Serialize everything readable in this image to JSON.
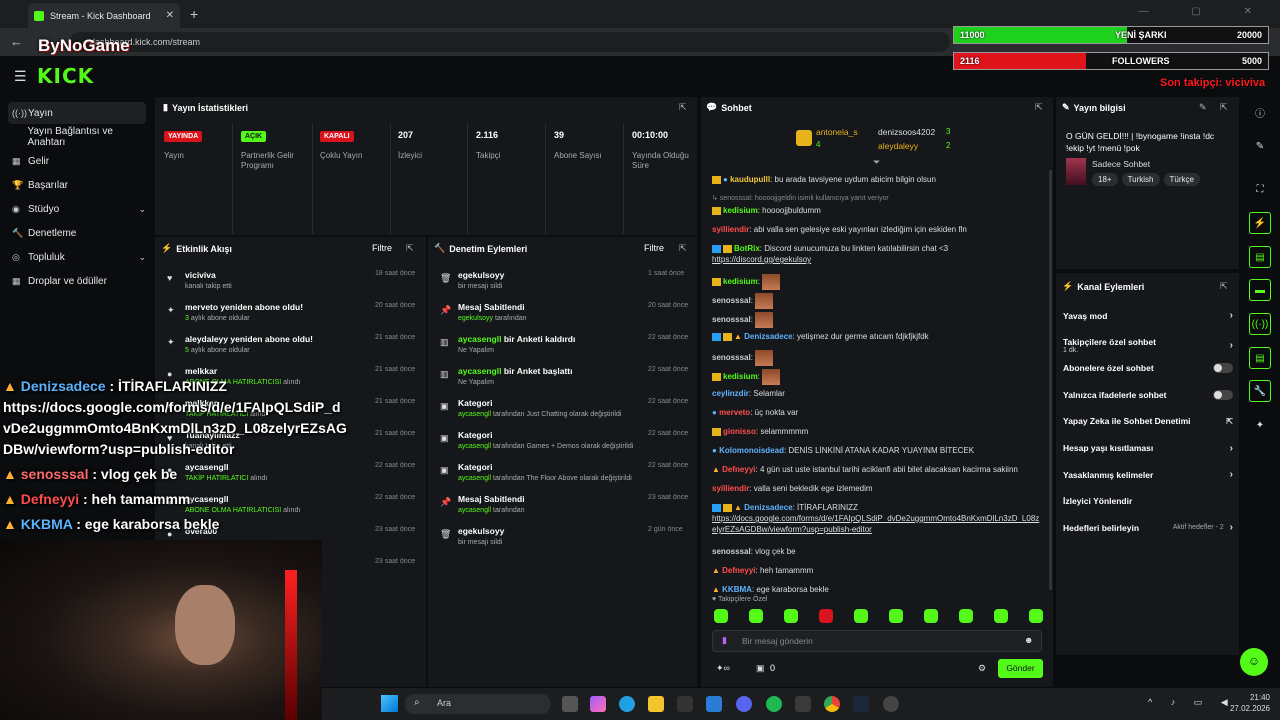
{
  "browser": {
    "tab_title": "Stream - Kick Dashboard",
    "url": "dashboard.kick.com/stream",
    "new_tab": "+",
    "close": "✕",
    "winctl": "— ▢ ✕"
  },
  "overlay_logo": "ByNoGame",
  "logo": "KICK",
  "goals": [
    {
      "left": "11000",
      "label": "YENİ ŞARKI",
      "right": "20000",
      "fill_fraction": 0.55,
      "color": "#1fd11f"
    },
    {
      "left": "2116",
      "label": "FOLLOWERS",
      "right": "5000",
      "fill_fraction": 0.42,
      "color": "#e0151c"
    }
  ],
  "last_follower": "Son takipçi: viciviva",
  "sidebar": [
    {
      "label": "Yayın",
      "icon": "((·))",
      "active": true
    },
    {
      "label": "Yayın Bağlantısı ve Anahtarı",
      "icon": ""
    },
    {
      "label": "Gelir",
      "icon": "▦"
    },
    {
      "label": "Başarılar",
      "icon": "🏆"
    },
    {
      "label": "Stüdyo",
      "icon": "◉",
      "chevron": "⌄"
    },
    {
      "label": "Denetleme",
      "icon": "🔨"
    },
    {
      "label": "Topluluk",
      "icon": "◎",
      "chevron": "⌄"
    },
    {
      "label": "Droplar ve ödüller",
      "icon": "▦"
    }
  ],
  "stats": {
    "title": "Yayın İstatistikleri",
    "items": [
      {
        "value": "YAYINDA",
        "label": "Yayın",
        "badge": "#d9131b"
      },
      {
        "value": "AÇIK",
        "label": "Partnerlik Gelir Programı",
        "badge": "#53fc18"
      },
      {
        "value": "KAPALI",
        "label": "Çoklu Yayın",
        "badge": "#d9131b"
      },
      {
        "value": "207",
        "label": "İzleyici"
      },
      {
        "value": "2.116",
        "label": "Takipçi"
      },
      {
        "value": "39",
        "label": "Abone Sayısı"
      },
      {
        "value": "00:10:00",
        "label": "Yayında Olduğu Süre"
      }
    ]
  },
  "activity": {
    "title": "Etkinlik Akışı",
    "filter": "Filtre",
    "rows": [
      {
        "title": "viciviva",
        "sub": "kanalı takip etti",
        "time": "18 saat önce",
        "icon": "♥"
      },
      {
        "title": "merveto yeniden abone oldu!",
        "sub_green": "3",
        "sub": " aylık abone oldular",
        "time": "20 saat önce",
        "icon": "✦"
      },
      {
        "title": "aleydaleyy yeniden abone oldu!",
        "sub_green": "5",
        "sub": " aylık abone oldular",
        "time": "21 saat önce",
        "icon": "✦"
      },
      {
        "title": "melkkar",
        "sub_green": "ABONE OLMA HATIRLATICISI",
        "sub": " alındı",
        "time": "21 saat önce",
        "icon": "●"
      },
      {
        "title": "melkkar",
        "sub_green": "TAKİP HATIRLATICI",
        "sub": " alındı",
        "time": "21 saat önce",
        "icon": "●"
      },
      {
        "title": "Tuanaylimazz",
        "sub": "kanalı takip etti",
        "time": "21 saat önce",
        "icon": "♥"
      },
      {
        "title": "aycasengll",
        "sub_green": "TAKİP HATIRLATICI",
        "sub": " alındı",
        "time": "22 saat önce",
        "icon": "●"
      },
      {
        "title": "aycasengll",
        "sub_green": "ABONE OLMA HATIRLATICISI",
        "sub": " alındı",
        "time": "22 saat önce",
        "icon": "●"
      },
      {
        "title": "overa00",
        "sub": "",
        "time": "23 saat önce",
        "icon": "●"
      },
      {
        "title": "",
        "sub": "",
        "time": "23 saat önce",
        "icon": ""
      }
    ]
  },
  "moderation": {
    "title": "Denetim Eylemleri",
    "filter": "Filtre",
    "rows": [
      {
        "title": "egekulsoyy",
        "sub": "bir mesajı sildi",
        "time": "1 saat önce",
        "icon": "🗑"
      },
      {
        "title": "Mesaj Sabitlendi",
        "sub_green": "egekulsoyy",
        "sub": " tarafından",
        "time": "20 saat önce",
        "icon": "📌"
      },
      {
        "title_green": "aycasengll",
        "title": " bir Anketi kaldırdı",
        "sub": "Ne Yapalım",
        "time": "22 saat önce",
        "icon": "▥"
      },
      {
        "title_green": "aycasengll",
        "title": " bir Anket başlattı",
        "sub": "Ne Yapalım",
        "time": "22 saat önce",
        "icon": "▥"
      },
      {
        "title": "Kategori",
        "sub_green": "aycasengll",
        "sub": " tarafından Just Chatting olarak değiştirildi",
        "time": "22 saat önce",
        "icon": "▣"
      },
      {
        "title": "Kategori",
        "sub_green": "aycasengll",
        "sub": " tarafından Games + Demos olarak değiştirildi",
        "time": "22 saat önce",
        "icon": "▣"
      },
      {
        "title": "Kategori",
        "sub_green": "aycasengll",
        "sub": " tarafından The Floor Above olarak değiştirildi",
        "time": "22 saat önce",
        "icon": "▣"
      },
      {
        "title": "Mesaj Sabitlendi",
        "sub_green": "aycasengll",
        "sub": " tarafından",
        "time": "23 saat önce",
        "icon": "📌"
      },
      {
        "title": "egekulsoyy",
        "sub": "bir mesajı sildi",
        "time": "2 gün önce",
        "icon": "🗑"
      }
    ]
  },
  "chat": {
    "title": "Sohbet",
    "top_users": [
      {
        "name": "antonela_s",
        "count": "4"
      },
      {
        "name": "denizsoos4202",
        "count": "3"
      },
      {
        "name": "aleydaleyy",
        "count": "2"
      }
    ],
    "messages": [
      {
        "user": "kaudupulll",
        "color": "#f0c93a",
        "text": ": bu arada tavsiyene uydum abicim bilgin olsun",
        "badges": "crown drop"
      },
      {
        "reply": "↳ senosssal: hoooojjgeldin isimli kullanıcıya yanıt veriyor"
      },
      {
        "user": "kedisium",
        "color": "#53fc18",
        "text": ": hoooojjbuldumm",
        "badges": "crown"
      },
      {
        "user": "syilliendir",
        "color": "#ff4d4d",
        "text": ": abi valla sen gelesiye eski yayınları izlediğim için eskiden fln",
        "badges": ""
      },
      {
        "user": "BotRix",
        "color": "#53fc18",
        "text": ": Discord sunucumuza bu linkten katılabilirsin chat <3",
        "link": "https://discord.gg/egekulsoy",
        "badges": "blue crown"
      },
      {
        "user": "kedisium",
        "color": "#53fc18",
        "text": ":",
        "emote": true,
        "badges": "crown"
      },
      {
        "user": "senosssal",
        "color": "#cccccc",
        "text": ":",
        "emote": true,
        "badges": ""
      },
      {
        "user": "senosssal",
        "color": "#cccccc",
        "text": ":",
        "emote": true,
        "badges": ""
      },
      {
        "user": "Denizsadece",
        "color": "#5cb3ff",
        "text": ": yetişmez dur germe atıcam fdjkfjkjfdk",
        "badges": "blue crown fire"
      },
      {
        "user": "senosssal",
        "color": "#cccccc",
        "text": ":",
        "emote": true,
        "badges": ""
      },
      {
        "user": "kedisium",
        "color": "#53fc18",
        "text": ":",
        "emote": true,
        "badges": "crown"
      },
      {
        "user": "ceylinzdir",
        "color": "#5cb3ff",
        "text": ": Selamlar",
        "badges": ""
      },
      {
        "user": "merveto",
        "color": "#ff4d4d",
        "text": ": üç nokta var",
        "badges": "drop"
      },
      {
        "user": "gionisso",
        "color": "#ff4d4d",
        "text": ": selammmmm",
        "badges": "crown"
      },
      {
        "user": "Kolomonoisdead",
        "color": "#5cb3ff",
        "text": ": DENİS LİNKİNİ ATANA KADAR YUAYINM BİTECEK",
        "badges": "drop"
      },
      {
        "user": "Defneyyi",
        "color": "#ff4d4d",
        "text": ": 4 gün ust uste istanbul tarihi aciklanfi abii bilet alacaksan kacirma sakiinn",
        "badges": "fire"
      },
      {
        "user": "syilliendir",
        "color": "#ff4d4d",
        "text": ": valla seni bekledik ege izlemedim",
        "badges": ""
      },
      {
        "user": "Denizsadece",
        "color": "#5cb3ff",
        "text": ": İTİRAFLARINIZZ",
        "link": "https://docs.google.com/forms/d/e/1FAIpQLSdiP_dvDe2uggmmOmto4BnKxmDlLn3zD_L08zelyrEZsAGDBw/viewform?usp=publish-editor",
        "badges": "blue crown fire"
      },
      {
        "user": "senosssal",
        "color": "#cccccc",
        "text": ": vlog çek be",
        "badges": ""
      },
      {
        "user": "Defneyyi",
        "color": "#ff4d4d",
        "text": ": heh tamammm",
        "badges": "fire"
      },
      {
        "user": "KKBMA",
        "color": "#5cb3ff",
        "text": ": ege karaborsa bekle",
        "badges": "fire"
      }
    ],
    "followers_only": "Takipçilere Özel",
    "input_placeholder": "Bir mesaj gönderin",
    "points": "0",
    "send": "Gönder"
  },
  "stream_info": {
    "title": "Yayın bilgisi",
    "stream_title": "O GÜN GELDİ!!! | !bynogame !insta !dc !ekip !yt !menü !pok",
    "category": "Sadece Sohbet",
    "tags": [
      "18+",
      "Turkish",
      "Türkçe"
    ]
  },
  "channel_actions": {
    "title": "Kanal Eylemleri",
    "items": [
      {
        "label": "Yavaş mod",
        "control": "chevron"
      },
      {
        "label": "Takipçilere özel sohbet",
        "sub": "1 dk.",
        "control": "chevron"
      },
      {
        "label": "Abonelere özel sohbet",
        "control": "toggle"
      },
      {
        "label": "Yalnızca ifadelerle sohbet",
        "control": "toggle"
      },
      {
        "label": "Yapay Zeka ile Sohbet Denetimi",
        "control": "external"
      },
      {
        "label": "Hesap yaşı kısıtlaması",
        "control": "chevron"
      },
      {
        "label": "Yasaklanmış kelimeler",
        "control": "chevron"
      },
      {
        "label": "İzleyici Yönlendir",
        "control": ""
      },
      {
        "label": "Hedefleri belirleyin",
        "extra": "Aktif hedefler - 2",
        "control": "chevron"
      }
    ]
  },
  "overlay_chat": [
    {
      "user": "Denizsadece",
      "text": " : İTİRAFLARINIZZ",
      "color": "#5cb3ff"
    },
    {
      "text": "https://docs.google.com/forms/d/e/1FAIpQLSdiP_d"
    },
    {
      "text": "vDe2uggmmOmto4BnKxmDlLn3zD_L08zelyrEZsAG"
    },
    {
      "text": "DBw/viewform?usp=publish-editor"
    },
    {
      "user": "senosssal",
      "text": " : vlog çek be",
      "color": "#ff6a6a"
    },
    {
      "user": "Defneyyi",
      "text": " : heh tamammm",
      "color": "#ff4d4d"
    },
    {
      "user": "KKBMA",
      "text": " : ege karaborsa bekle",
      "color": "#5cb3ff"
    }
  ],
  "taskbar": {
    "search": "Ara",
    "time": "21:40",
    "date": "27.02.2026"
  }
}
